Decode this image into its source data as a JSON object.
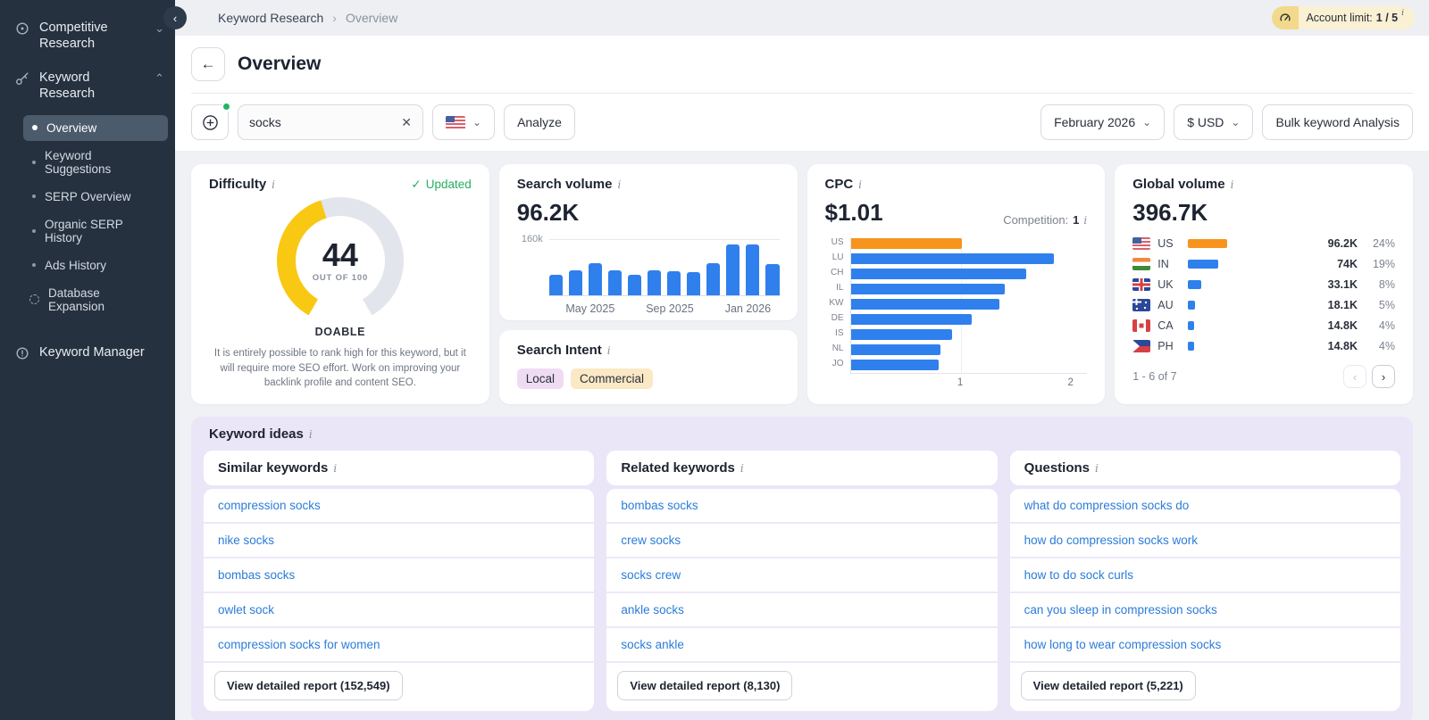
{
  "colors": {
    "accent_blue": "#2f80ed",
    "accent_orange": "#f7941d",
    "gauge_yellow": "#f8c812",
    "gauge_track": "#e3e5ec",
    "green": "#27ae60",
    "link_blue": "#2b7cd9",
    "sidebar_bg": "#25313f",
    "lavender_panel": "#eae6f8"
  },
  "sidebar": {
    "competitive_research_label": "Competitive Research",
    "keyword_research_label": "Keyword Research",
    "keyword_manager_label": "Keyword Manager",
    "submenu": [
      {
        "label": "Overview",
        "active": true
      },
      {
        "label": "Keyword Suggestions"
      },
      {
        "label": "SERP Overview"
      },
      {
        "label": "Organic SERP History"
      },
      {
        "label": "Ads History"
      },
      {
        "label": "Database Expansion",
        "icon": "refresh-expand-icon"
      }
    ]
  },
  "topbar": {
    "breadcrumb_parent": "Keyword Research",
    "breadcrumb_sep": "›",
    "breadcrumb_current": "Overview",
    "account_limit_label": "Account limit:",
    "account_limit_value": "1 / 5",
    "account_info_sup": "i"
  },
  "header": {
    "title": "Overview",
    "back_glyph": "←"
  },
  "toolbar": {
    "keyword_value": "socks",
    "clear_glyph": "✕",
    "analyze_label": "Analyze",
    "period_value": "February 2026",
    "currency_value": "$ USD",
    "bulk_label": "Bulk keyword Analysis",
    "chevron_glyph": "⌄"
  },
  "difficulty": {
    "title": "Difficulty",
    "status": "Updated",
    "check_glyph": "✓",
    "score": 44,
    "score_display": "44",
    "out_of_label": "OUT OF 100",
    "verdict": "DOABLE",
    "description": "It is entirely possible to rank high for this keyword, but it will require more SEO effort. Work on improving your backlink profile and content SEO."
  },
  "search_volume": {
    "title": "Search volume",
    "value": "96.2K",
    "y_axis_label": "160k"
  },
  "search_intent": {
    "title": "Search Intent",
    "badges": [
      "Local",
      "Commercial"
    ]
  },
  "cpc": {
    "title": "CPC",
    "value": "$1.01",
    "competition_label": "Competition:",
    "competition_value": "1"
  },
  "global_volume": {
    "title": "Global volume",
    "value": "396.7K",
    "pagination": "1 - 6 of 7",
    "prev_glyph": "‹",
    "next_glyph": "›"
  },
  "keyword_ideas": {
    "title": "Keyword ideas",
    "columns": [
      {
        "title": "Similar keywords",
        "items": [
          "compression socks",
          "nike socks",
          "bombas socks",
          "owlet sock",
          "compression socks for women"
        ],
        "report_label": "View detailed report (152,549)"
      },
      {
        "title": "Related keywords",
        "items": [
          "bombas socks",
          "crew socks",
          "socks crew",
          "ankle socks",
          "socks ankle"
        ],
        "report_label": "View detailed report (8,130)"
      },
      {
        "title": "Questions",
        "items": [
          "what do compression socks do",
          "how do compression socks work",
          "how to do sock curls",
          "can you sleep in compression socks",
          "how long to wear compression socks"
        ],
        "report_label": "View detailed report (5,221)"
      }
    ]
  },
  "chart_data": [
    {
      "type": "bar",
      "title": "Search volume trend",
      "x_tick_labels": [
        "May 2025",
        "Sep 2025",
        "Jan 2026"
      ],
      "x_tick_positions": [
        2,
        6,
        10
      ],
      "values_k": [
        58,
        70,
        90,
        70,
        58,
        70,
        68,
        66,
        90,
        142,
        142,
        88
      ],
      "ylim_k": [
        0,
        160
      ],
      "bar_color": "#2f80ed"
    },
    {
      "type": "bar",
      "orientation": "horizontal",
      "title": "CPC by country",
      "categories": [
        "US",
        "LU",
        "CH",
        "IL",
        "KW",
        "DE",
        "IS",
        "NL",
        "JO"
      ],
      "values": [
        1.01,
        1.85,
        1.6,
        1.4,
        1.35,
        1.1,
        0.92,
        0.82,
        0.8
      ],
      "x_ticks": [
        "1",
        "2"
      ],
      "xlim": [
        0,
        2.15
      ],
      "highlight_index": 0,
      "highlight_color": "#f7941d",
      "bar_color": "#2f80ed"
    },
    {
      "type": "table",
      "title": "Global volume by country",
      "rows": [
        {
          "code": "US",
          "volume": "96.2K",
          "volume_k": 96.2,
          "pct": "24%",
          "highlight": true
        },
        {
          "code": "IN",
          "volume": "74K",
          "volume_k": 74,
          "pct": "19%"
        },
        {
          "code": "UK",
          "volume": "33.1K",
          "volume_k": 33.1,
          "pct": "8%"
        },
        {
          "code": "AU",
          "volume": "18.1K",
          "volume_k": 18.1,
          "pct": "5%"
        },
        {
          "code": "CA",
          "volume": "14.8K",
          "volume_k": 14.8,
          "pct": "4%"
        },
        {
          "code": "PH",
          "volume": "14.8K",
          "volume_k": 14.8,
          "pct": "4%"
        }
      ]
    }
  ]
}
